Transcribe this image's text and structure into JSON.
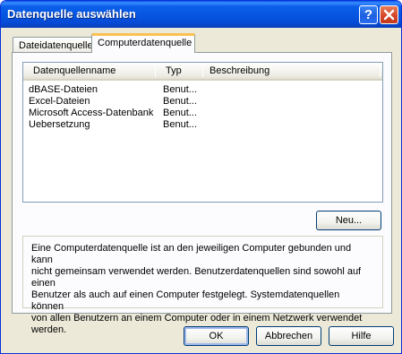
{
  "window": {
    "title": "Datenquelle auswählen"
  },
  "tabs": [
    {
      "label": "Dateidatenquelle"
    },
    {
      "label": "Computerdatenquelle"
    }
  ],
  "list": {
    "columns": [
      "Datenquellenname",
      "Typ",
      "Beschreibung"
    ],
    "rows": [
      {
        "name": "dBASE-Dateien",
        "type": "Benut...",
        "description": ""
      },
      {
        "name": "Excel-Dateien",
        "type": "Benut...",
        "description": ""
      },
      {
        "name": "Microsoft Access-Datenbank",
        "type": "Benut...",
        "description": ""
      },
      {
        "name": "Uebersetzung",
        "type": "Benut...",
        "description": ""
      }
    ]
  },
  "buttons": {
    "new": "Neu...",
    "ok": "OK",
    "cancel": "Abbrechen",
    "help": "Hilfe"
  },
  "info": {
    "lines": [
      "Eine Computerdatenquelle ist an den jeweiligen Computer gebunden und kann",
      "nicht gemeinsam verwendet werden. Benutzerdatenquellen sind sowohl auf einen",
      "Benutzer als auch auf einen Computer festgelegt. Systemdatenquellen können",
      "von allen Benutzern an einem Computer oder in einem Netzwerk verwendet",
      "werden."
    ]
  },
  "colors": {
    "titlebar": "#0554e0",
    "dialog_bg": "#ece9d8",
    "active_tab_accent": "#fbc251"
  },
  "icons": {
    "help": "question-mark-icon",
    "close": "close-x-icon"
  }
}
